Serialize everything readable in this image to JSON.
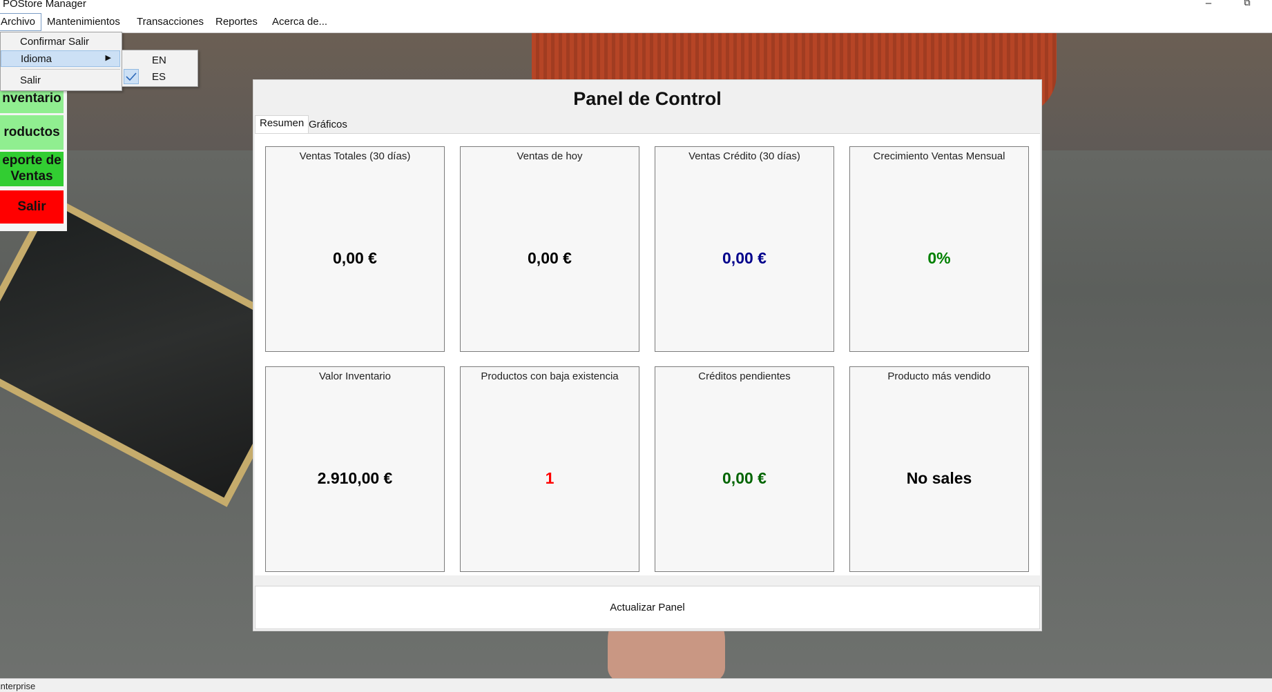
{
  "window": {
    "title": "POStore Manager",
    "minimize_glyph": "–",
    "restore_glyph": "⧉"
  },
  "menubar": {
    "items": [
      "Archivo",
      "Mantenimientos",
      "Transacciones",
      "Reportes",
      "Acerca de..."
    ]
  },
  "file_menu": {
    "items": [
      "Confirmar Salir",
      "Idioma",
      "Salir"
    ],
    "language_submenu": {
      "options": [
        "EN",
        "ES"
      ],
      "checked": "ES"
    }
  },
  "side_buttons": [
    {
      "label": "nventario",
      "color": "#90ee90"
    },
    {
      "label": "roductos",
      "color": "#90ee90"
    },
    {
      "label": "eporte de Ventas",
      "color": "#32cd32"
    },
    {
      "label": "Salir",
      "color": "#ff0000"
    }
  ],
  "dashboard": {
    "title": "Panel de Control",
    "tabs": [
      "Resumen",
      "Gráficos"
    ],
    "active_tab": "Resumen",
    "cards": [
      {
        "label": "Ventas Totales (30 días)",
        "value": "0,00 €",
        "color": "#000000"
      },
      {
        "label": "Ventas de hoy",
        "value": "0,00 €",
        "color": "#000000"
      },
      {
        "label": "Ventas Crédito (30 días)",
        "value": "0,00 €",
        "color": "#00008b"
      },
      {
        "label": "Crecimiento Ventas Mensual",
        "value": "0%",
        "color": "#008000"
      },
      {
        "label": "Valor Inventario",
        "value": "2.910,00 €",
        "color": "#000000"
      },
      {
        "label": "Productos con baja existencia",
        "value": "1",
        "color": "#ff0000"
      },
      {
        "label": "Créditos pendientes",
        "value": "0,00 €",
        "color": "#006400"
      },
      {
        "label": "Producto más vendido",
        "value": "No sales",
        "color": "#000000"
      }
    ],
    "refresh_button": "Actualizar Panel"
  },
  "statusbar": {
    "text": "Enterprise"
  }
}
